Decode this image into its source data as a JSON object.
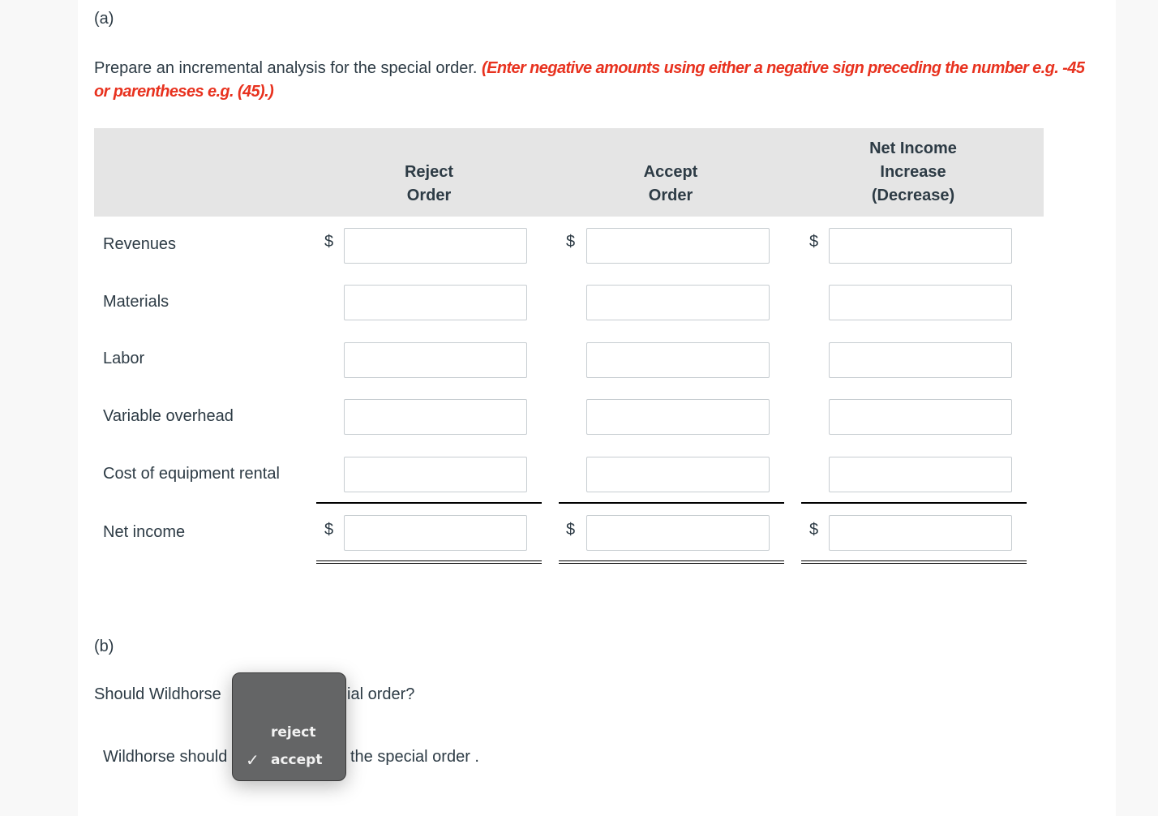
{
  "part_a": {
    "label": "(a)",
    "instruction": "Prepare an incremental analysis for the special order.",
    "hint": "(Enter negative amounts using either a negative sign preceding the number e.g. -45 or parentheses e.g. (45).)"
  },
  "table": {
    "columns": [
      {
        "line1": "",
        "line2": "Reject",
        "line3": "Order"
      },
      {
        "line1": "",
        "line2": "Accept",
        "line3": "Order"
      },
      {
        "line1": "Net Income",
        "line2": "Increase",
        "line3": "(Decrease)"
      }
    ],
    "currency_symbol": "$",
    "rows": [
      {
        "label": "Revenues",
        "values": [
          "",
          "",
          ""
        ],
        "show_currency": true
      },
      {
        "label": "Materials",
        "values": [
          "",
          "",
          ""
        ],
        "show_currency": false
      },
      {
        "label": "Labor",
        "values": [
          "",
          "",
          ""
        ],
        "show_currency": false
      },
      {
        "label": "Variable overhead",
        "values": [
          "",
          "",
          ""
        ],
        "show_currency": false
      },
      {
        "label": "Cost of equipment rental",
        "values": [
          "",
          "",
          ""
        ],
        "show_currency": false
      },
      {
        "label": "Net income",
        "values": [
          "",
          "",
          ""
        ],
        "show_currency": true
      }
    ]
  },
  "part_b": {
    "label": "(b)",
    "question_left": "Should Wildhorse",
    "question_right": "ial order?",
    "answer_left": "Wildhorse should",
    "answer_right": "the special order .",
    "dropdown": {
      "options": [
        {
          "label": "reject",
          "selected": false
        },
        {
          "label": "accept",
          "selected": true
        }
      ],
      "check_glyph": "✓"
    }
  }
}
